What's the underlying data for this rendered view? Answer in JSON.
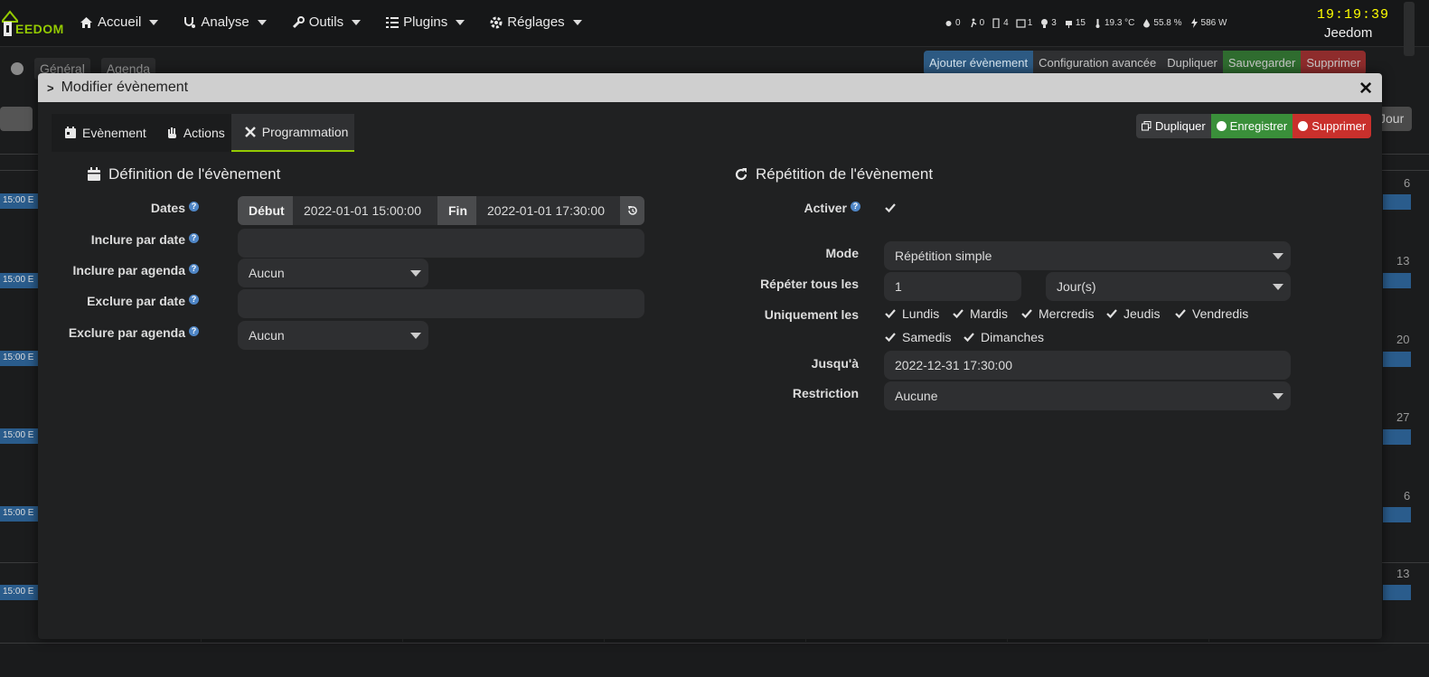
{
  "navbar": {
    "brand": "EEDOM",
    "menu": [
      {
        "label": "Accueil",
        "icon": "home-icon"
      },
      {
        "label": "Analyse",
        "icon": "stethoscope-icon"
      },
      {
        "label": "Outils",
        "icon": "wrench-icon"
      },
      {
        "label": "Plugins",
        "icon": "tasks-icon"
      },
      {
        "label": "Réglages",
        "icon": "gear-icon"
      }
    ],
    "status": [
      {
        "icon": "light-icon",
        "value": "0"
      },
      {
        "icon": "motion-icon",
        "value": "0"
      },
      {
        "icon": "door-icon",
        "value": "4"
      },
      {
        "icon": "window-icon",
        "value": "1"
      },
      {
        "icon": "bulb-icon",
        "value": "3"
      },
      {
        "icon": "plug-icon",
        "value": "15"
      },
      {
        "icon": "thermometer-icon",
        "value": "19.3 °C"
      },
      {
        "icon": "humidity-icon",
        "value": "55.8 %"
      },
      {
        "icon": "power-icon",
        "value": "586 W"
      }
    ],
    "clock": "19:19:39",
    "user": "Jeedom"
  },
  "background": {
    "tabs": [
      "Général",
      "Agenda"
    ],
    "actions": [
      "Ajouter évènement",
      "Configuration avancée",
      "Dupliquer",
      "Sauvegarder",
      "Supprimer"
    ],
    "jour_label": "Jour",
    "event_label": "15:00 E",
    "day_numbers": [
      "6",
      "13",
      "20",
      "27",
      "6",
      "13"
    ]
  },
  "modal": {
    "title": "Modifier évènement",
    "tabs": [
      {
        "label": "Evènement",
        "icon": "calendar-icon"
      },
      {
        "label": "Actions",
        "icon": "hand-icon"
      },
      {
        "label": "Programmation",
        "icon": "tools-icon",
        "active": true
      }
    ],
    "buttons": {
      "duplicate": "Dupliquer",
      "save": "Enregistrer",
      "delete": "Supprimer"
    },
    "definition": {
      "title": "Définition de l'évènement",
      "dates_label": "Dates",
      "start_label": "Début",
      "start_value": "2022-01-01 15:00:00",
      "end_label": "Fin",
      "end_value": "2022-01-01 17:30:00",
      "include_date_label": "Inclure par date",
      "include_date_value": "",
      "include_agenda_label": "Inclure par agenda",
      "include_agenda_value": "Aucun",
      "exclude_date_label": "Exclure par date",
      "exclude_date_value": "",
      "exclude_agenda_label": "Exclure par agenda",
      "exclude_agenda_value": "Aucun"
    },
    "repetition": {
      "title": "Répétition de l'évènement",
      "enable_label": "Activer",
      "enabled": true,
      "mode_label": "Mode",
      "mode_value": "Répétition simple",
      "repeat_label": "Répéter tous les",
      "repeat_value": "1",
      "repeat_unit": "Jour(s)",
      "only_label": "Uniquement les",
      "days": [
        "Lundis",
        "Mardis",
        "Mercredis",
        "Jeudis",
        "Vendredis",
        "Samedis",
        "Dimanches"
      ],
      "until_label": "Jusqu'à",
      "until_value": "2022-12-31 17:30:00",
      "restriction_label": "Restriction",
      "restriction_value": "Aucune"
    }
  }
}
